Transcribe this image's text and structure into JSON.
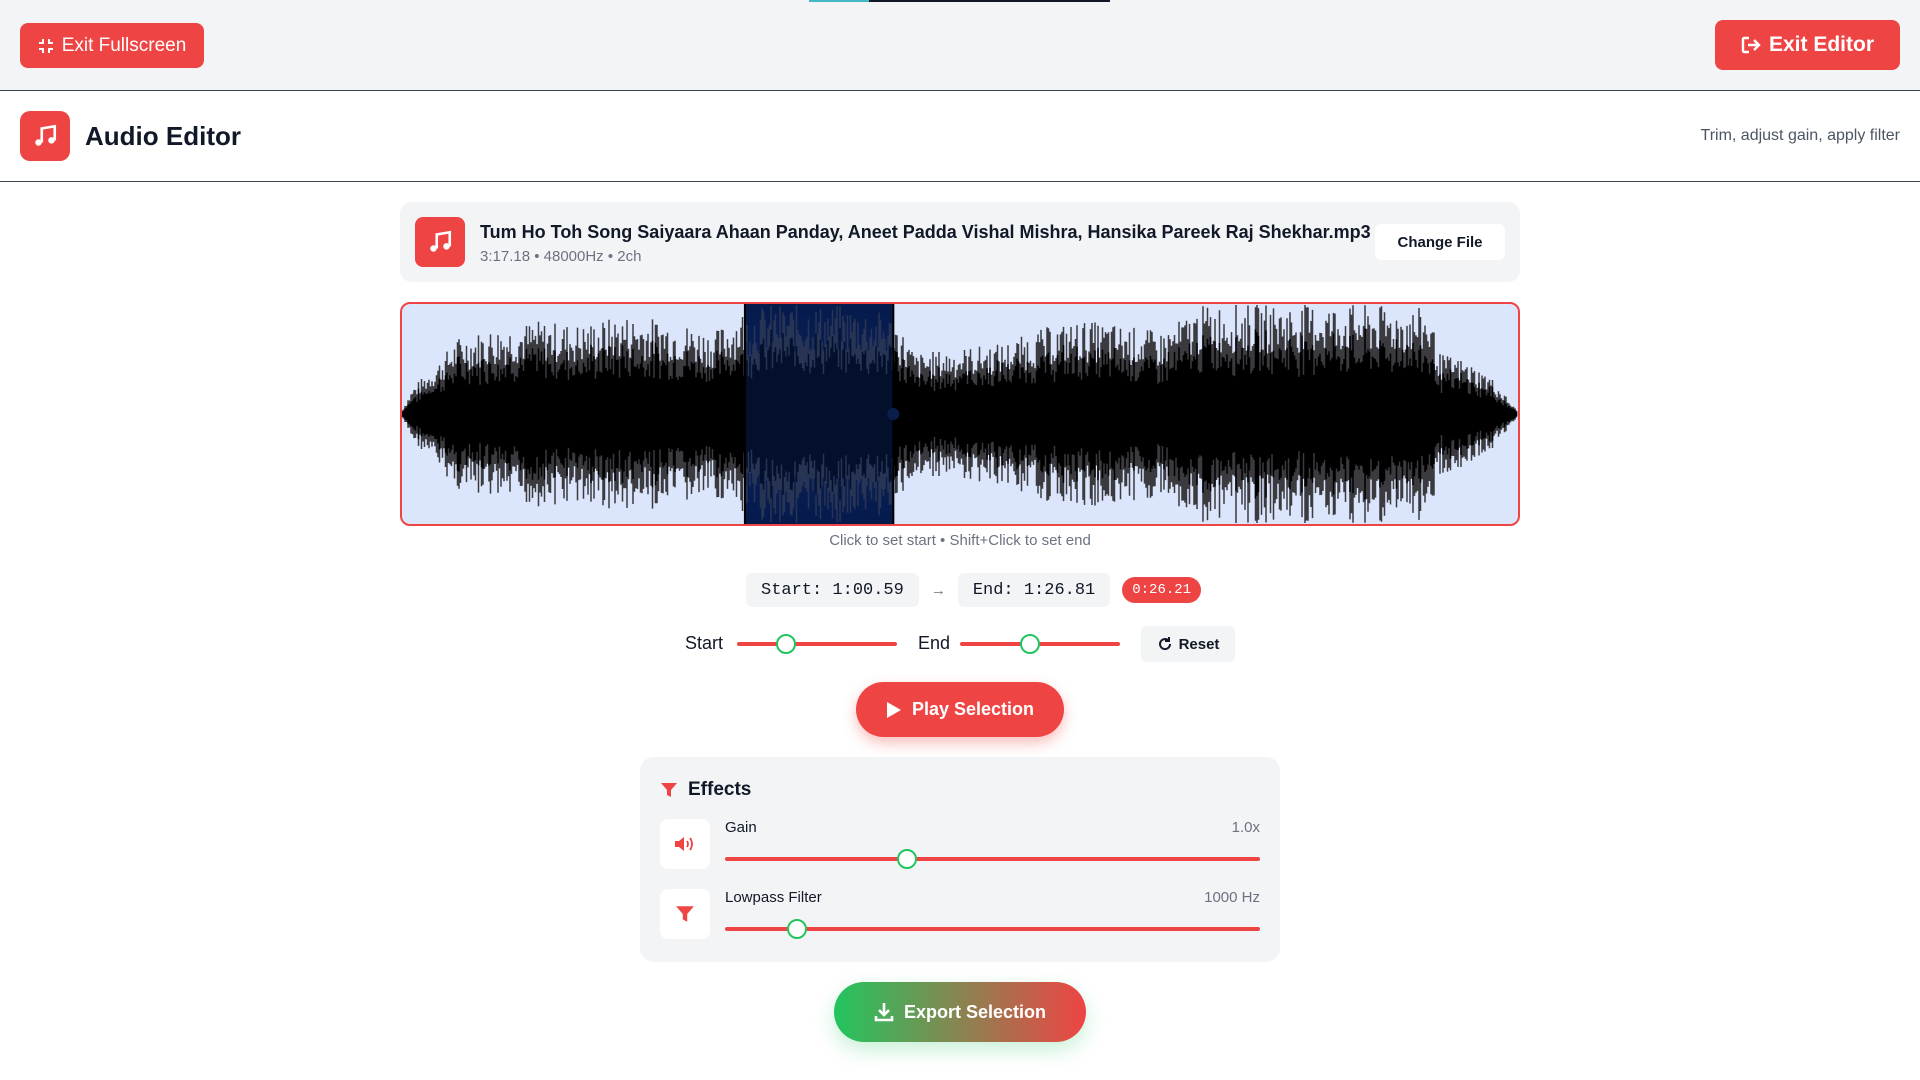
{
  "topbar": {
    "exit_fullscreen_label": "Exit Fullscreen",
    "exit_editor_label": "Exit Editor"
  },
  "header": {
    "title": "Audio Editor",
    "subtitle": "Trim, adjust gain, apply filter"
  },
  "file": {
    "name": "Tum Ho Toh Song Saiyaara Ahaan Panday, Aneet Padda Vishal Mishra, Hansika Pareek Raj Shekhar.mp3",
    "meta": "3:17.18 • 48000Hz • 2ch",
    "change_label": "Change File"
  },
  "waveform": {
    "hint": "Click to set start • Shift+Click to set end",
    "duration_seconds": 197.18,
    "selection_start_seconds": 60.59,
    "selection_end_seconds": 86.81
  },
  "selection": {
    "start_text": "Start: 1:00.59",
    "arrow": "→",
    "end_text": "End: 1:26.81",
    "duration_text": "0:26.21"
  },
  "trim": {
    "start_label": "Start",
    "end_label": "End",
    "start_fraction": 0.307,
    "end_fraction": 0.44,
    "reset_label": "Reset"
  },
  "play_label": "Play Selection",
  "effects": {
    "title": "Effects",
    "gain": {
      "label": "Gain",
      "value_text": "1.0x",
      "fraction": 0.34
    },
    "lowpass": {
      "label": "Lowpass Filter",
      "value_text": "1000 Hz",
      "fraction": 0.135
    }
  },
  "export_label": "Export Selection",
  "colors": {
    "accent": "#ef4444",
    "success": "#22c55e",
    "waveform_bg": "#dbe5fb",
    "selection": "#0a1a3e"
  }
}
